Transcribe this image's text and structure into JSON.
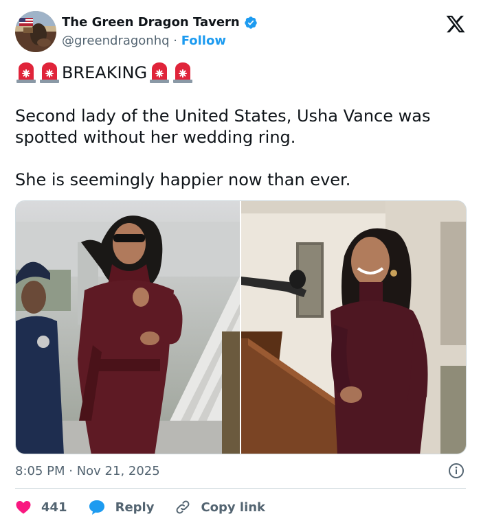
{
  "tweet": {
    "author": {
      "display_name": "The Green Dragon Tavern",
      "handle": "@greendragonhq",
      "separator": " · ",
      "follow_label": "Follow",
      "verified": true,
      "verified_color": "#1d9bf0"
    },
    "headline": "BREAKING",
    "body_paragraphs": [
      "Second lady of the United States, Usha Vance was spotted without her wedding ring.",
      "She is seemingly happier now than ever."
    ],
    "images": [
      {
        "icon": "photo-left"
      },
      {
        "icon": "photo-right"
      }
    ],
    "timestamp": "8:05 PM · Nov 21, 2025",
    "actions": {
      "like_count": "441",
      "reply_label": "Reply",
      "copy_link_label": "Copy link"
    }
  },
  "colors": {
    "accent": "#1d9bf0",
    "like": "#f91880",
    "text": "#0f1419",
    "muted": "#536471",
    "border": "#cfd9de"
  }
}
